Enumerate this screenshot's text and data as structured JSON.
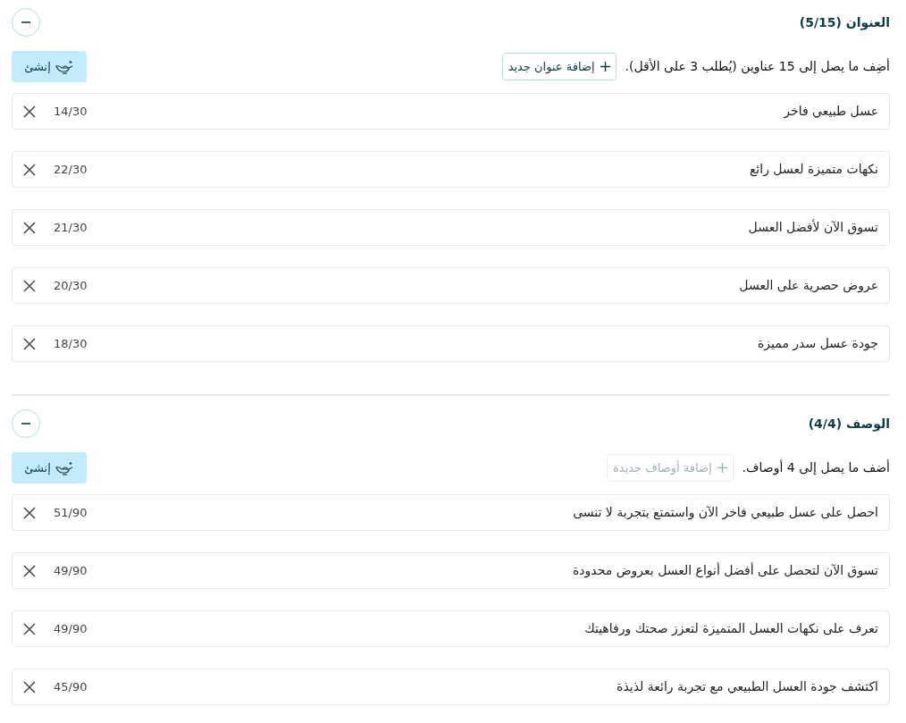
{
  "sections": [
    {
      "title": "العنوان (5/15)",
      "expanded": true,
      "instruction": "أضِف ما يصل إلى 15 عناوين (يُطلب 3 على الأقل).",
      "add_button": {
        "label": "إضافة عنوان جديد",
        "disabled": false
      },
      "generate_button": "إنشئ",
      "items": [
        {
          "text": "عسل طبيعي فاخر",
          "count": "14/30"
        },
        {
          "text": "نكهات متميزة لعسل رائع",
          "count": "22/30"
        },
        {
          "text": "تسوق الآن لأفضل العسل",
          "count": "21/30"
        },
        {
          "text": "عروض حصرية على العسل",
          "count": "20/30"
        },
        {
          "text": "جودة عسل سدر مميزة",
          "count": "18/30"
        }
      ]
    },
    {
      "title": "الوصف (4/4)",
      "expanded": true,
      "instruction": "أضف ما يصل إلى 4 أوصاف.",
      "add_button": {
        "label": "إضافة أوصاف جديدة",
        "disabled": true
      },
      "generate_button": "إنشئ",
      "items": [
        {
          "text": "احصل على عسل طبيعي فاخر الآن واستمتع بتجربة لا تنسى",
          "count": "51/90"
        },
        {
          "text": "تسوق الآن لتحصل على أفضل أنواع العسل بعروض محدودة",
          "count": "49/90"
        },
        {
          "text": "تعرف على نكهات العسل المتميزة لتعزز صحتك ورفاهيتك",
          "count": "49/90"
        },
        {
          "text": "اكتشف جودة العسل الطبيعي مع تجربة رائعة لذيذة",
          "count": "45/90"
        }
      ]
    }
  ]
}
